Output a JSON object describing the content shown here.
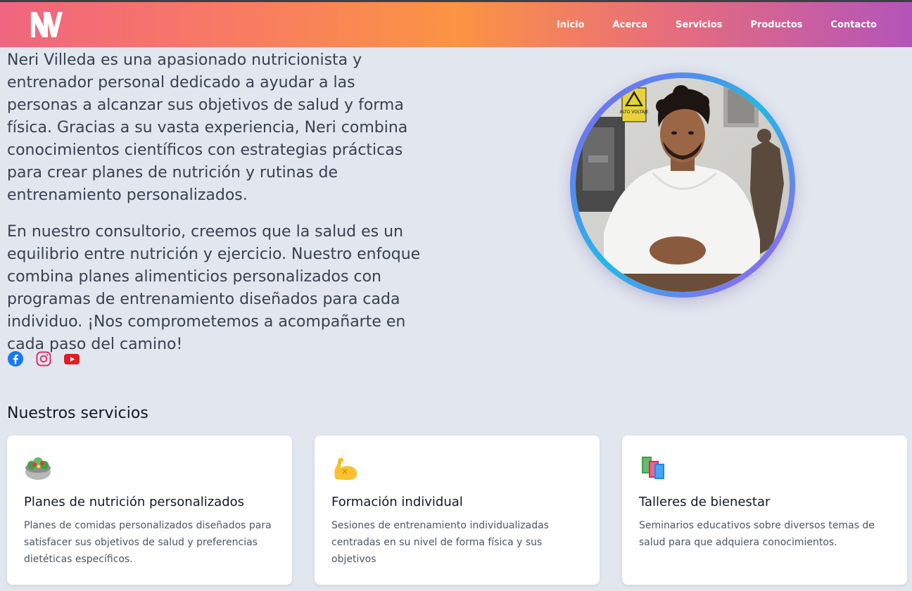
{
  "nav": {
    "logo_text": "NV",
    "links": [
      {
        "label": "Inicio"
      },
      {
        "label": "Acerca"
      },
      {
        "label": "Servicios"
      },
      {
        "label": "Productos"
      },
      {
        "label": "Contacto"
      }
    ]
  },
  "about": {
    "paragraphs": [
      "Neri Villeda es una apasionado nutricionista y entrenador personal dedicado a ayudar a las personas a alcanzar sus objetivos de salud y forma física. Gracias a su vasta experiencia, Neri combina conocimientos científicos con estrategias prácticas para crear planes de nutrición y rutinas de entrenamiento personalizados.",
      "En nuestro consultorio, creemos que la salud es un equilibrio entre nutrición y ejercicio. Nuestro enfoque combina planes alimenticios personalizados con programas de entrenamiento diseñados para cada individuo. ¡Nos comprometemos a acompañarte en cada paso del camino!"
    ],
    "photo_sign": "ALTO VOLTAJE"
  },
  "social": [
    {
      "icon": "facebook-icon",
      "color": "#1877f2"
    },
    {
      "icon": "instagram-icon",
      "color": "#e1306c"
    },
    {
      "icon": "youtube-icon",
      "color": "#e11d24"
    }
  ],
  "services": {
    "title": "Nuestros servicios",
    "cards": [
      {
        "icon": "salad-icon",
        "title": "Planes de nutrición personalizados",
        "description": "Planes de comidas personalizados diseñados para satisfacer sus objetivos de salud y preferencias dietéticas específicos."
      },
      {
        "icon": "flexed-biceps-icon",
        "title": "Formación individual",
        "description": "Sesiones de entrenamiento individualizadas centradas en su nivel de forma física y sus objetivos"
      },
      {
        "icon": "books-icon",
        "title": "Talleres de bienestar",
        "description": "Seminarios educativos sobre diversos temas de salud para que adquiera conocimientos."
      }
    ]
  },
  "colors": {
    "nav_gradient": [
      "#f0657f",
      "#fb9443",
      "#b454ba"
    ],
    "page_bg": "#e2e6ee",
    "avatar_ring": [
      "#8b5cf6",
      "#22b8e6"
    ]
  }
}
